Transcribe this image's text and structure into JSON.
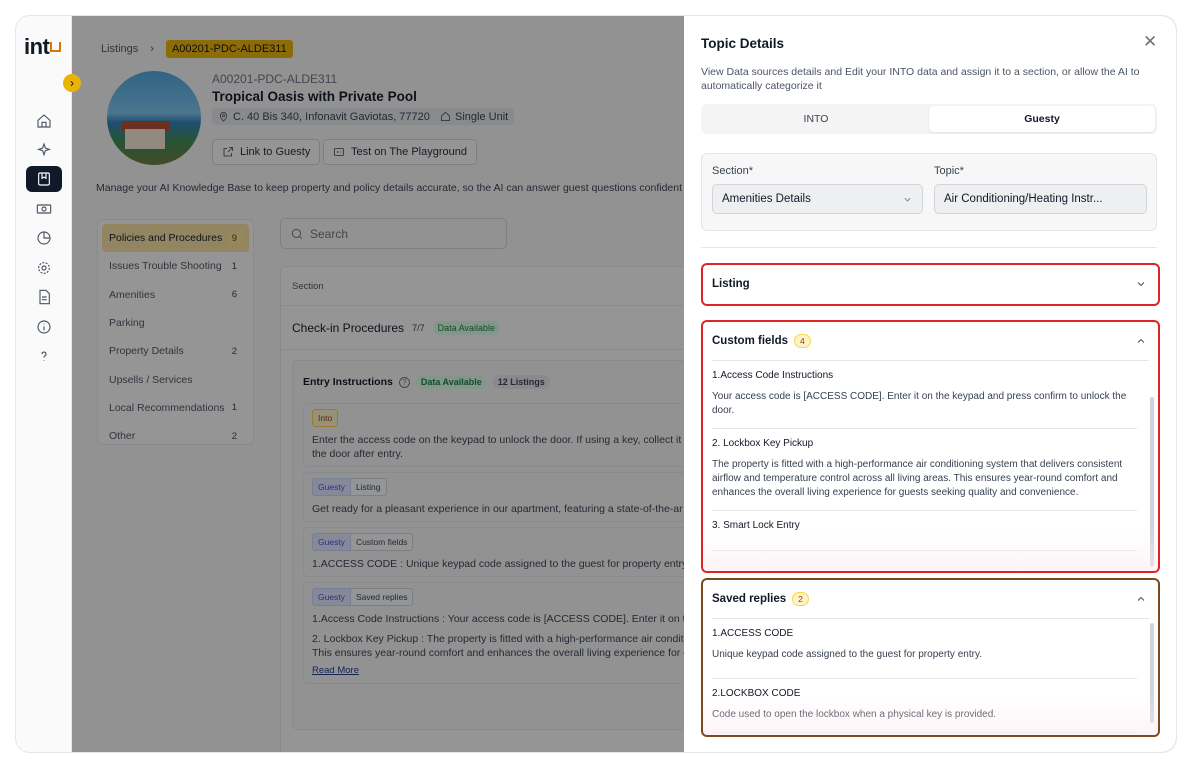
{
  "app": {
    "logo_text": "int"
  },
  "breadcrumb": {
    "root": "Listings",
    "current": "A00201-PDC-ALDE311"
  },
  "listing": {
    "id": "A00201-PDC-ALDE311",
    "title": "Tropical Oasis with Private Pool",
    "address": "C. 40 Bis 340, Infonavit Gaviotas, 77720",
    "unit_type": "Single Unit",
    "link_button": "Link to Guesty",
    "playground_button": "Test on The Playground"
  },
  "manage_text": "Manage your AI Knowledge Base to keep property and policy details accurate, so the AI can answer guest questions confident",
  "categories": [
    {
      "label": "Policies and Procedures",
      "count": "9"
    },
    {
      "label": "Issues Trouble Shooting",
      "count": "1"
    },
    {
      "label": "Amenities",
      "count": "6"
    },
    {
      "label": "Parking",
      "count": ""
    },
    {
      "label": "Property Details",
      "count": "2"
    },
    {
      "label": "Upsells / Services",
      "count": ""
    },
    {
      "label": "Local Recommendations",
      "count": "1"
    },
    {
      "label": "Other",
      "count": "2"
    }
  ],
  "search": {
    "placeholder": "Search"
  },
  "section_panel": {
    "header": "Section",
    "row_title": "Check-in Procedures",
    "row_fraction": "7/7",
    "row_badge": "Data Available",
    "entry_title": "Entry Instructions",
    "entry_badge": "Data Available",
    "entry_listings": "12 Listings",
    "cards": [
      {
        "tags": [
          "Into"
        ],
        "lines": [
          "Enter the access code on the keypad to unlock the door. If using a key, collect it f",
          "the door after entry."
        ]
      },
      {
        "tags": [
          "Guesty",
          "Listing"
        ],
        "lines": [
          "Get ready for a pleasant experience in our apartment, featuring a state-of-the-ar"
        ]
      },
      {
        "tags": [
          "Guesty",
          "Custom fields"
        ],
        "lines": [
          "1.ACCESS CODE : Unique keypad code assigned to the guest for property entry."
        ]
      },
      {
        "tags": [
          "Guesty",
          "Saved replies"
        ],
        "lines": [
          "1.Access Code Instructions : Your access code is [ACCESS CODE]. Enter it on the",
          "2. Lockbox Key Pickup : The property is fitted with a high-performance air condit",
          "This ensures year-round comfort and enhances the overall living experience for g"
        ]
      }
    ],
    "read_more": "Read More"
  },
  "drawer": {
    "title": "Topic Details",
    "close_icon": "close-icon",
    "description": "View Data sources details and Edit your INTO data and assign it to a section, or allow the AI to automatically categorize it",
    "tabs": [
      {
        "label": "INTO"
      },
      {
        "label": "Guesty"
      }
    ],
    "section_label": "Section*",
    "section_value": "Amenities Details",
    "topic_label": "Topic*",
    "topic_value": "Air Conditioning/Heating Instr...",
    "listing_title": "Listing",
    "custom_fields": {
      "title": "Custom fields",
      "count": "4",
      "items": [
        {
          "title": "1.Access Code Instructions",
          "text": "Your access code is [ACCESS CODE]. Enter it on the keypad and press confirm to unlock the door."
        },
        {
          "title": "2. Lockbox Key Pickup",
          "text": "The property is fitted with a high-performance air conditioning system that delivers consistent airflow and temperature control across all living areas. This ensures year-round comfort and enhances the overall living experience for guests seeking quality and convenience."
        },
        {
          "title": "3. Smart Lock Entry",
          "text": ""
        }
      ]
    },
    "saved_replies": {
      "title": "Saved replies",
      "count": "2",
      "items": [
        {
          "title": "1.ACCESS CODE",
          "text": "Unique keypad code assigned to the guest for property entry."
        },
        {
          "title": "2.LOCKBOX CODE",
          "text": "Code used to open the lockbox when a physical key is provided."
        }
      ]
    }
  },
  "colors": {
    "accent": "#eab308",
    "highlight_red": "#dc2626",
    "highlight_brown": "#7c4a1f",
    "rail_active": "#111827"
  }
}
